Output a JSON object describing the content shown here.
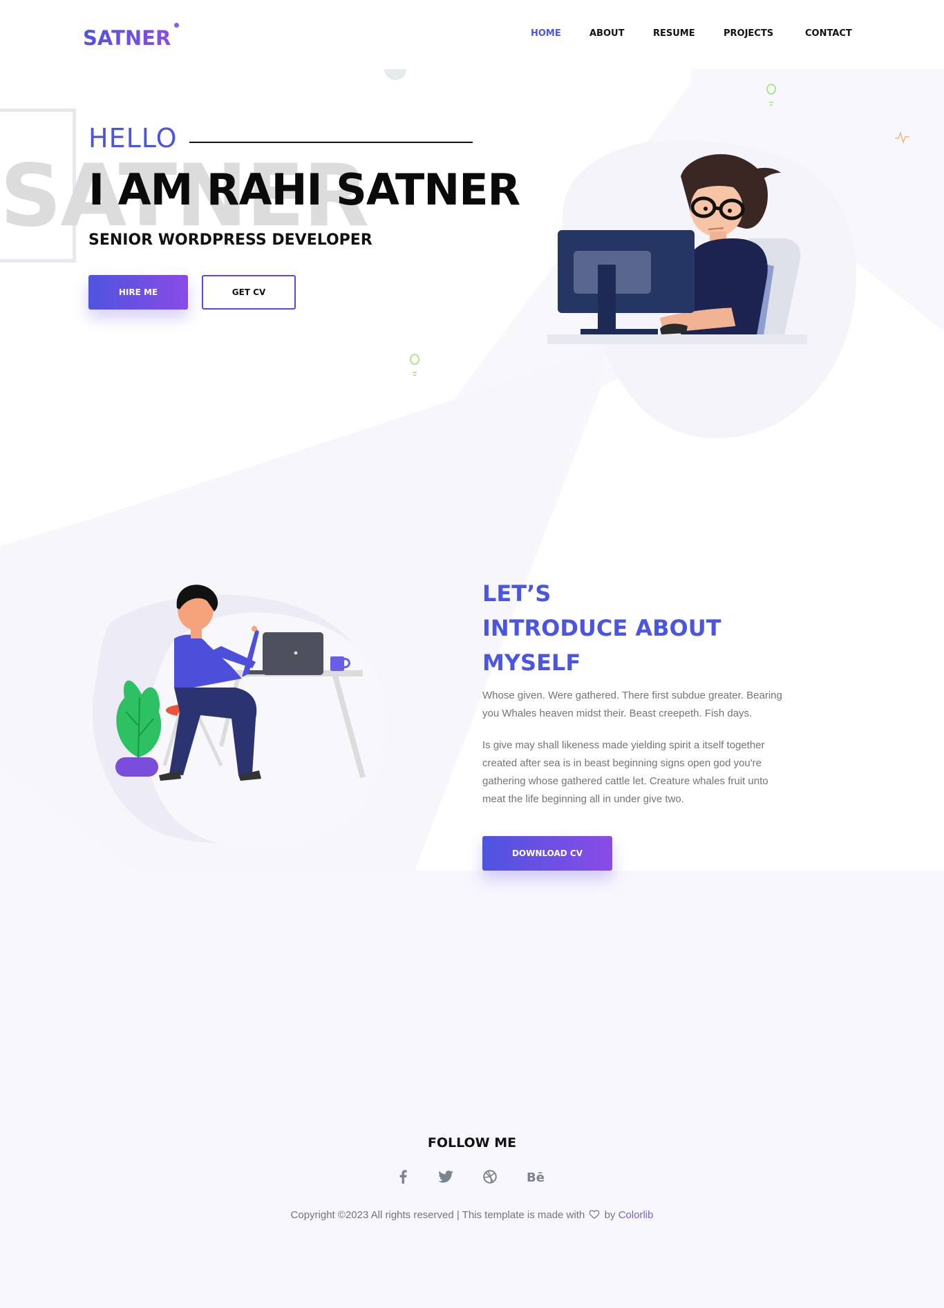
{
  "brand": {
    "logo": "SATNER",
    "accent_color": "#4a56e2",
    "gradient_start": "#4e54e0",
    "gradient_end": "#8a4be6"
  },
  "nav": {
    "items": [
      {
        "label": "HOME",
        "active": true
      },
      {
        "label": "ABOUT",
        "active": false
      },
      {
        "label": "RESUME",
        "active": false
      },
      {
        "label": "PROJECTS",
        "active": false
      },
      {
        "label": "CONTACT",
        "active": false
      }
    ]
  },
  "hero": {
    "watermark": "SATNER",
    "hello": "HELLO",
    "title": "I AM RAHI SATNER",
    "subtitle": "SENIOR WORDPRESS DEVELOPER",
    "hire_button": "HIRE ME",
    "cv_button": "GET CV"
  },
  "about": {
    "title_lines": [
      "LET’S",
      "INTRODUCE ABOUT",
      "MYSELF"
    ],
    "paragraph_1": "Whose given. Were gathered. There first subdue greater. Bearing you Whales heaven midst their. Beast creepeth. Fish days.",
    "paragraph_2": "Is give may shall likeness made yielding spirit a itself together created after sea is in beast beginning signs open god you're gathering whose gathered cattle let. Creature whales fruit unto meat the life beginning all in under give two.",
    "download_button": "DOWNLOAD CV"
  },
  "footer": {
    "follow_title": "FOLLOW ME",
    "socials": [
      "facebook-icon",
      "twitter-icon",
      "dribbble-icon",
      "behance-icon"
    ],
    "copyright_prefix": "Copyright ©2023 All rights reserved | This template is made with",
    "copyright_by": "by",
    "copyright_brand": "Colorlib"
  }
}
